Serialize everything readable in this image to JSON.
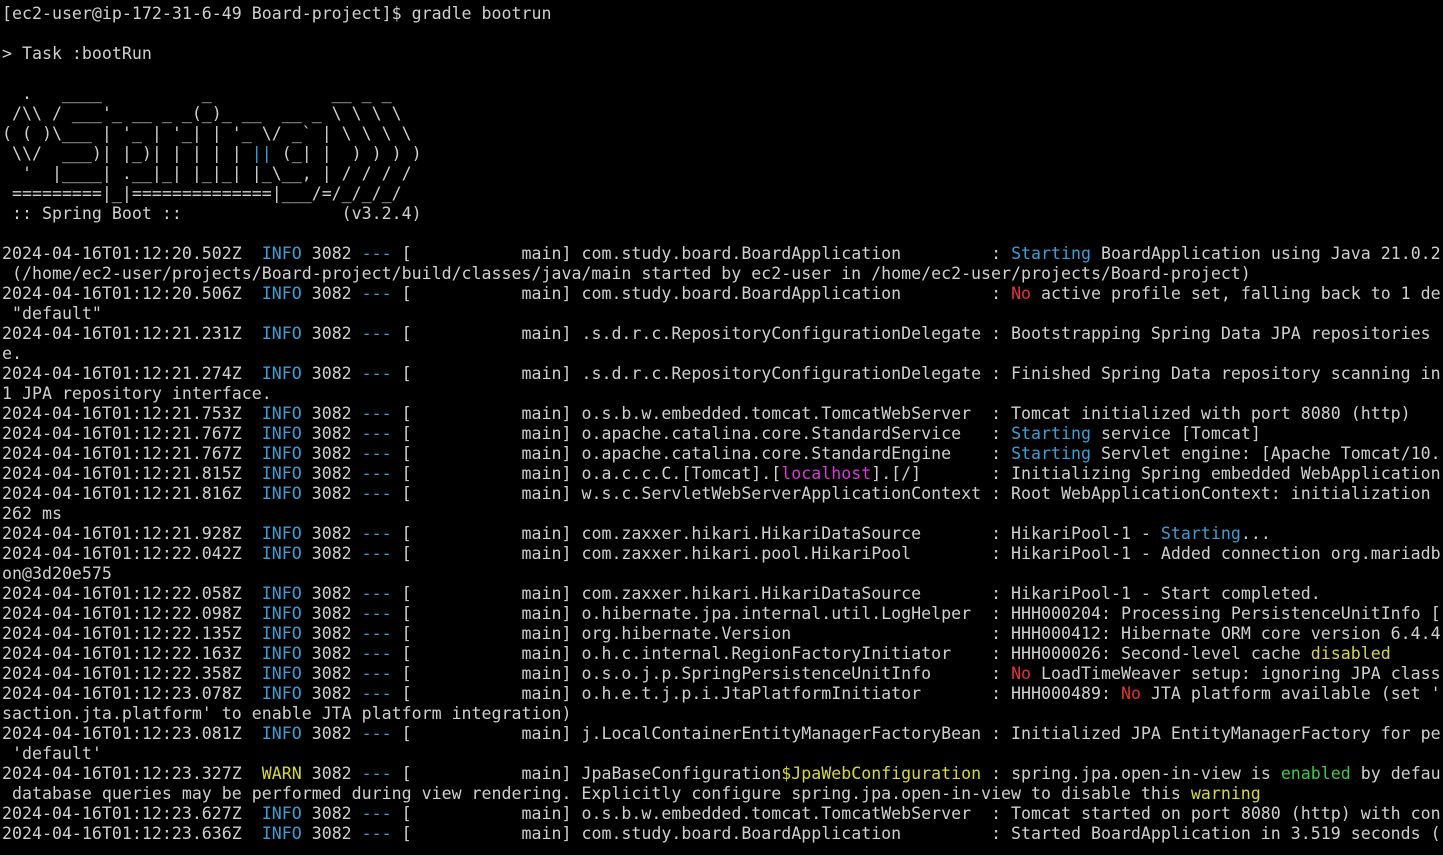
{
  "palette": {
    "background": "#000000",
    "default": "#d0d0d0",
    "blue": "#3a9fd6",
    "red": "#e8303a",
    "yellow": "#d8d83c",
    "green": "#3ccb48",
    "magenta": "#d838d8"
  },
  "terminal": {
    "lines": [
      {
        "kind": "prompt",
        "segments": [
          {
            "t": "[ec2-user@ip-172-31-6-49 Board-project]$ gradle bootrun",
            "c": "default"
          }
        ]
      },
      {
        "kind": "blank",
        "segments": []
      },
      {
        "kind": "task",
        "segments": [
          {
            "t": "> Task :bootRun",
            "c": "default"
          }
        ]
      },
      {
        "kind": "blank",
        "segments": []
      },
      {
        "kind": "banner",
        "segments": [
          {
            "t": "  .   ____          _            __ _ _",
            "c": "default"
          }
        ]
      },
      {
        "kind": "banner",
        "segments": [
          {
            "t": " /\\\\ / ___'_ __ _ _(_)_ __  __ _ \\ \\ \\ \\",
            "c": "default"
          }
        ]
      },
      {
        "kind": "banner",
        "segments": [
          {
            "t": "( ( )\\___ | '_ | '_| | '_ \\/ _` | \\ \\ \\ \\",
            "c": "default"
          }
        ]
      },
      {
        "kind": "banner",
        "segments": [
          {
            "t": " \\\\/  ___)| |_)| | | | | ",
            "c": "default"
          },
          {
            "t": "||",
            "c": "blue"
          },
          {
            "t": " (_| |  ) ) ) )",
            "c": "default"
          }
        ]
      },
      {
        "kind": "banner",
        "segments": [
          {
            "t": "  '  |____| .__|_| |_|_| |_\\__, | / / / /",
            "c": "default"
          }
        ]
      },
      {
        "kind": "banner",
        "segments": [
          {
            "t": " =========|_|==============|___/=/_/_/_/",
            "c": "default"
          }
        ]
      },
      {
        "kind": "banner",
        "segments": [
          {
            "t": " :: Spring Boot ::                (v3.2.4)",
            "c": "default"
          }
        ]
      },
      {
        "kind": "blank",
        "segments": []
      },
      {
        "kind": "log",
        "segments": [
          {
            "t": "2024-04-16T01:12:20.502Z  ",
            "c": "default"
          },
          {
            "t": "INFO",
            "c": "blue"
          },
          {
            "t": " 3082 ",
            "c": "default"
          },
          {
            "t": "---",
            "c": "blue"
          },
          {
            "t": " [           main] com.study.board.BoardApplication         : ",
            "c": "default"
          },
          {
            "t": "Starting",
            "c": "blue"
          },
          {
            "t": " BoardApplication using Java 21.0.2",
            "c": "default"
          }
        ]
      },
      {
        "kind": "wrap",
        "segments": [
          {
            "t": " (/home/ec2-user/projects/Board-project/build/classes/java/main started by ec2-user in /home/ec2-user/projects/Board-project)",
            "c": "default"
          }
        ]
      },
      {
        "kind": "log",
        "segments": [
          {
            "t": "2024-04-16T01:12:20.506Z  ",
            "c": "default"
          },
          {
            "t": "INFO",
            "c": "blue"
          },
          {
            "t": " 3082 ",
            "c": "default"
          },
          {
            "t": "---",
            "c": "blue"
          },
          {
            "t": " [           main] com.study.board.BoardApplication         : ",
            "c": "default"
          },
          {
            "t": "No",
            "c": "red"
          },
          {
            "t": " active profile set, falling back to 1 de",
            "c": "default"
          }
        ]
      },
      {
        "kind": "wrap",
        "segments": [
          {
            "t": " \"default\"",
            "c": "default"
          }
        ]
      },
      {
        "kind": "log",
        "segments": [
          {
            "t": "2024-04-16T01:12:21.231Z  ",
            "c": "default"
          },
          {
            "t": "INFO",
            "c": "blue"
          },
          {
            "t": " 3082 ",
            "c": "default"
          },
          {
            "t": "---",
            "c": "blue"
          },
          {
            "t": " [           main] .s.d.r.c.RepositoryConfigurationDelegate : Bootstrapping Spring Data JPA repositories",
            "c": "default"
          }
        ]
      },
      {
        "kind": "wrap",
        "segments": [
          {
            "t": "e.",
            "c": "default"
          }
        ]
      },
      {
        "kind": "log",
        "segments": [
          {
            "t": "2024-04-16T01:12:21.274Z  ",
            "c": "default"
          },
          {
            "t": "INFO",
            "c": "blue"
          },
          {
            "t": " 3082 ",
            "c": "default"
          },
          {
            "t": "---",
            "c": "blue"
          },
          {
            "t": " [           main] .s.d.r.c.RepositoryConfigurationDelegate : Finished Spring Data repository scanning in",
            "c": "default"
          }
        ]
      },
      {
        "kind": "wrap",
        "segments": [
          {
            "t": "1 JPA repository interface.",
            "c": "default"
          }
        ]
      },
      {
        "kind": "log",
        "segments": [
          {
            "t": "2024-04-16T01:12:21.753Z  ",
            "c": "default"
          },
          {
            "t": "INFO",
            "c": "blue"
          },
          {
            "t": " 3082 ",
            "c": "default"
          },
          {
            "t": "---",
            "c": "blue"
          },
          {
            "t": " [           main] o.s.b.w.embedded.tomcat.TomcatWebServer  : Tomcat initialized with port 8080 (http)",
            "c": "default"
          }
        ]
      },
      {
        "kind": "log",
        "segments": [
          {
            "t": "2024-04-16T01:12:21.767Z  ",
            "c": "default"
          },
          {
            "t": "INFO",
            "c": "blue"
          },
          {
            "t": " 3082 ",
            "c": "default"
          },
          {
            "t": "---",
            "c": "blue"
          },
          {
            "t": " [           main] o.apache.catalina.core.StandardService   : ",
            "c": "default"
          },
          {
            "t": "Starting",
            "c": "blue"
          },
          {
            "t": " service [Tomcat]",
            "c": "default"
          }
        ]
      },
      {
        "kind": "log",
        "segments": [
          {
            "t": "2024-04-16T01:12:21.767Z  ",
            "c": "default"
          },
          {
            "t": "INFO",
            "c": "blue"
          },
          {
            "t": " 3082 ",
            "c": "default"
          },
          {
            "t": "---",
            "c": "blue"
          },
          {
            "t": " [           main] o.apache.catalina.core.StandardEngine    : ",
            "c": "default"
          },
          {
            "t": "Starting",
            "c": "blue"
          },
          {
            "t": " Servlet engine: [Apache Tomcat/10.",
            "c": "default"
          }
        ]
      },
      {
        "kind": "log",
        "segments": [
          {
            "t": "2024-04-16T01:12:21.815Z  ",
            "c": "default"
          },
          {
            "t": "INFO",
            "c": "blue"
          },
          {
            "t": " 3082 ",
            "c": "default"
          },
          {
            "t": "---",
            "c": "blue"
          },
          {
            "t": " [           main] o.a.c.c.C.[Tomcat].[",
            "c": "default"
          },
          {
            "t": "localhost",
            "c": "magenta"
          },
          {
            "t": "].[/]       : Initializing Spring embedded WebApplication",
            "c": "default"
          }
        ]
      },
      {
        "kind": "log",
        "segments": [
          {
            "t": "2024-04-16T01:12:21.816Z  ",
            "c": "default"
          },
          {
            "t": "INFO",
            "c": "blue"
          },
          {
            "t": " 3082 ",
            "c": "default"
          },
          {
            "t": "---",
            "c": "blue"
          },
          {
            "t": " [           main] w.s.c.ServletWebServerApplicationContext : Root WebApplicationContext: initialization",
            "c": "default"
          }
        ]
      },
      {
        "kind": "wrap",
        "segments": [
          {
            "t": "262 ms",
            "c": "default"
          }
        ]
      },
      {
        "kind": "log",
        "segments": [
          {
            "t": "2024-04-16T01:12:21.928Z  ",
            "c": "default"
          },
          {
            "t": "INFO",
            "c": "blue"
          },
          {
            "t": " 3082 ",
            "c": "default"
          },
          {
            "t": "---",
            "c": "blue"
          },
          {
            "t": " [           main] com.zaxxer.hikari.HikariDataSource       : HikariPool-1 - ",
            "c": "default"
          },
          {
            "t": "Starting",
            "c": "blue"
          },
          {
            "t": "...",
            "c": "default"
          }
        ]
      },
      {
        "kind": "log",
        "segments": [
          {
            "t": "2024-04-16T01:12:22.042Z  ",
            "c": "default"
          },
          {
            "t": "INFO",
            "c": "blue"
          },
          {
            "t": " 3082 ",
            "c": "default"
          },
          {
            "t": "---",
            "c": "blue"
          },
          {
            "t": " [           main] com.zaxxer.hikari.pool.HikariPool        : HikariPool-1 - Added connection org.mariadb",
            "c": "default"
          }
        ]
      },
      {
        "kind": "wrap",
        "segments": [
          {
            "t": "on@3d20e575",
            "c": "default"
          }
        ]
      },
      {
        "kind": "log",
        "segments": [
          {
            "t": "2024-04-16T01:12:22.058Z  ",
            "c": "default"
          },
          {
            "t": "INFO",
            "c": "blue"
          },
          {
            "t": " 3082 ",
            "c": "default"
          },
          {
            "t": "---",
            "c": "blue"
          },
          {
            "t": " [           main] com.zaxxer.hikari.HikariDataSource       : HikariPool-1 - Start completed.",
            "c": "default"
          }
        ]
      },
      {
        "kind": "log",
        "segments": [
          {
            "t": "2024-04-16T01:12:22.098Z  ",
            "c": "default"
          },
          {
            "t": "INFO",
            "c": "blue"
          },
          {
            "t": " 3082 ",
            "c": "default"
          },
          {
            "t": "---",
            "c": "blue"
          },
          {
            "t": " [           main] o.hibernate.jpa.internal.util.LogHelper  : HHH000204: Processing PersistenceUnitInfo [",
            "c": "default"
          }
        ]
      },
      {
        "kind": "log",
        "segments": [
          {
            "t": "2024-04-16T01:12:22.135Z  ",
            "c": "default"
          },
          {
            "t": "INFO",
            "c": "blue"
          },
          {
            "t": " 3082 ",
            "c": "default"
          },
          {
            "t": "---",
            "c": "blue"
          },
          {
            "t": " [           main] org.hibernate.Version                    : HHH000412: Hibernate ORM core version 6.4.4",
            "c": "default"
          }
        ]
      },
      {
        "kind": "log",
        "segments": [
          {
            "t": "2024-04-16T01:12:22.163Z  ",
            "c": "default"
          },
          {
            "t": "INFO",
            "c": "blue"
          },
          {
            "t": " 3082 ",
            "c": "default"
          },
          {
            "t": "---",
            "c": "blue"
          },
          {
            "t": " [           main] o.h.c.internal.RegionFactoryInitiator    : HHH000026: Second-level cache ",
            "c": "default"
          },
          {
            "t": "disabled",
            "c": "yellow"
          }
        ]
      },
      {
        "kind": "log",
        "segments": [
          {
            "t": "2024-04-16T01:12:22.358Z  ",
            "c": "default"
          },
          {
            "t": "INFO",
            "c": "blue"
          },
          {
            "t": " 3082 ",
            "c": "default"
          },
          {
            "t": "---",
            "c": "blue"
          },
          {
            "t": " [           main] o.s.o.j.p.SpringPersistenceUnitInfo      : ",
            "c": "default"
          },
          {
            "t": "No",
            "c": "red"
          },
          {
            "t": " LoadTimeWeaver setup: ignoring JPA class",
            "c": "default"
          }
        ]
      },
      {
        "kind": "log",
        "segments": [
          {
            "t": "2024-04-16T01:12:23.078Z  ",
            "c": "default"
          },
          {
            "t": "INFO",
            "c": "blue"
          },
          {
            "t": " 3082 ",
            "c": "default"
          },
          {
            "t": "---",
            "c": "blue"
          },
          {
            "t": " [           main] o.h.e.t.j.p.i.JtaPlatformInitiator       : HHH000489: ",
            "c": "default"
          },
          {
            "t": "No",
            "c": "red"
          },
          {
            "t": " JTA platform available (set '",
            "c": "default"
          }
        ]
      },
      {
        "kind": "wrap",
        "segments": [
          {
            "t": "saction.jta.platform' to enable JTA platform integration)",
            "c": "default"
          }
        ]
      },
      {
        "kind": "log",
        "segments": [
          {
            "t": "2024-04-16T01:12:23.081Z  ",
            "c": "default"
          },
          {
            "t": "INFO",
            "c": "blue"
          },
          {
            "t": " 3082 ",
            "c": "default"
          },
          {
            "t": "---",
            "c": "blue"
          },
          {
            "t": " [           main] j.LocalContainerEntityManagerFactoryBean : Initialized JPA EntityManagerFactory for pe",
            "c": "default"
          }
        ]
      },
      {
        "kind": "wrap",
        "segments": [
          {
            "t": " 'default'",
            "c": "default"
          }
        ]
      },
      {
        "kind": "log",
        "segments": [
          {
            "t": "2024-04-16T01:12:23.327Z  ",
            "c": "default"
          },
          {
            "t": "WARN",
            "c": "yellow"
          },
          {
            "t": " 3082 ",
            "c": "default"
          },
          {
            "t": "---",
            "c": "blue"
          },
          {
            "t": " [           main] JpaBaseConfiguration",
            "c": "default"
          },
          {
            "t": "$JpaWebConfiguration",
            "c": "yellow"
          },
          {
            "t": " : spring.jpa.open-in-view is ",
            "c": "default"
          },
          {
            "t": "enabled",
            "c": "green"
          },
          {
            "t": " by defau",
            "c": "default"
          }
        ]
      },
      {
        "kind": "wrap",
        "segments": [
          {
            "t": " database queries may be performed during view rendering. Explicitly configure spring.jpa.open-in-view to disable this ",
            "c": "default"
          },
          {
            "t": "warning",
            "c": "yellow"
          }
        ]
      },
      {
        "kind": "log",
        "segments": [
          {
            "t": "2024-04-16T01:12:23.627Z  ",
            "c": "default"
          },
          {
            "t": "INFO",
            "c": "blue"
          },
          {
            "t": " 3082 ",
            "c": "default"
          },
          {
            "t": "---",
            "c": "blue"
          },
          {
            "t": " [           main] o.s.b.w.embedded.tomcat.TomcatWebServer  : Tomcat started on port 8080 (http) with con",
            "c": "default"
          }
        ]
      },
      {
        "kind": "log",
        "segments": [
          {
            "t": "2024-04-16T01:12:23.636Z  ",
            "c": "default"
          },
          {
            "t": "INFO",
            "c": "blue"
          },
          {
            "t": " 3082 ",
            "c": "default"
          },
          {
            "t": "---",
            "c": "blue"
          },
          {
            "t": " [           main] com.study.board.BoardApplication         : Started BoardApplication in 3.519 seconds (",
            "c": "default"
          }
        ]
      }
    ]
  }
}
